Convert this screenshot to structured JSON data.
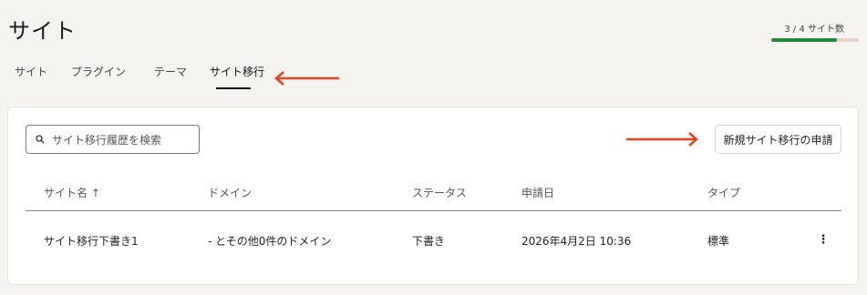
{
  "page": {
    "title": "サイト"
  },
  "usage": {
    "label": "3 / 4 サイト数",
    "used": 3,
    "total": 4,
    "fill_color": "#1f8a3a"
  },
  "tabs": [
    {
      "label": "サイト"
    },
    {
      "label": "プラグイン"
    },
    {
      "label": "テーマ"
    },
    {
      "label": "サイト移行",
      "active": true
    }
  ],
  "accent_arrow_color": "#e8431a",
  "search": {
    "placeholder": "サイト移行履歴を検索"
  },
  "actions": {
    "new_migration_label": "新規サイト移行の申請"
  },
  "table": {
    "columns": [
      "サイト名 ↑",
      "ドメイン",
      "ステータス",
      "申請日",
      "タイプ"
    ],
    "rows": [
      {
        "site_name": "サイト移行下書き1",
        "domain": "- とその他0件のドメイン",
        "status": "下書き",
        "date": "2026年4月2日 10:36",
        "type": "標準",
        "menu": "⋮"
      }
    ]
  }
}
